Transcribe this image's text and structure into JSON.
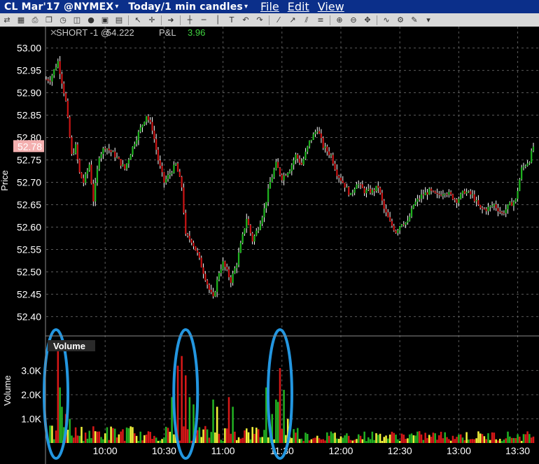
{
  "window": {
    "title": "CL Mar'17 @NYMEX",
    "title_arrow": "▾",
    "interval": "Today/1 min candles",
    "interval_arrow": "▾",
    "menu": [
      "File",
      "Edit",
      "View"
    ]
  },
  "toolbar": {
    "icons": [
      "arrow-icon",
      "grid-icon",
      "print-icon",
      "copy-icon",
      "clock-icon",
      "chart-icon",
      "circle-icon",
      "window-icon",
      "layout-icon",
      "sep",
      "cursor-icon",
      "crosshair-icon",
      "sep",
      "go-icon",
      "sep",
      "crosshair-line-icon",
      "hline-icon",
      "vline-icon",
      "text-icon",
      "undo-icon",
      "redo-icon",
      "sep",
      "trendline-icon",
      "ray-icon",
      "channel-icon",
      "fib-icon",
      "sep",
      "zoom-in-icon",
      "zoom-out-icon",
      "pan-icon",
      "sep",
      "indicator-icon",
      "settings-icon",
      "tools-icon",
      "chevron-down-icon"
    ]
  },
  "position": {
    "label": "SHORT -1 @",
    "price": "54.222",
    "pl_label": "P&L",
    "pl_value": "3.96",
    "close_glyph": "✕"
  },
  "colors": {
    "up": "#1fb31f",
    "down": "#c81414",
    "vol_up": "#22b022",
    "vol_down": "#d71818",
    "vol_flat": "#f2f23a",
    "annotation": "#2396e0",
    "last_price_bg": "#f4b0b0",
    "grid": "#5a5a5a"
  },
  "chart_data": [
    {
      "type": "candlestick",
      "title": "",
      "ylabel": "Price",
      "ylim": [
        52.36,
        53.04
      ],
      "y_ticks": [
        "53.00",
        "52.95",
        "52.90",
        "52.85",
        "52.80",
        "52.75",
        "52.70",
        "52.65",
        "52.60",
        "52.55",
        "52.50",
        "52.45",
        "52.40"
      ],
      "last_price": "52.78",
      "anchors": [
        [
          "09:32",
          52.93
        ],
        [
          "09:36",
          52.97
        ],
        [
          "09:40",
          52.88
        ],
        [
          "09:43",
          52.76
        ],
        [
          "09:45",
          52.78
        ],
        [
          "09:47",
          52.72
        ],
        [
          "09:49",
          52.7
        ],
        [
          "09:52",
          52.74
        ],
        [
          "09:54",
          52.66
        ],
        [
          "09:57",
          52.76
        ],
        [
          "10:00",
          52.78
        ],
        [
          "10:05",
          52.76
        ],
        [
          "10:10",
          52.73
        ],
        [
          "10:15",
          52.79
        ],
        [
          "10:18",
          52.82
        ],
        [
          "10:21",
          52.85
        ],
        [
          "10:24",
          52.82
        ],
        [
          "10:27",
          52.75
        ],
        [
          "10:30",
          52.7
        ],
        [
          "10:33",
          52.72
        ],
        [
          "10:36",
          52.74
        ],
        [
          "10:39",
          52.69
        ],
        [
          "10:41",
          52.58
        ],
        [
          "10:44",
          52.57
        ],
        [
          "10:47",
          52.54
        ],
        [
          "10:50",
          52.5
        ],
        [
          "10:53",
          52.46
        ],
        [
          "10:55",
          52.44
        ],
        [
          "10:58",
          52.5
        ],
        [
          "11:00",
          52.52
        ],
        [
          "11:04",
          52.48
        ],
        [
          "11:07",
          52.52
        ],
        [
          "11:10",
          52.58
        ],
        [
          "11:12",
          52.62
        ],
        [
          "11:15",
          52.57
        ],
        [
          "11:18",
          52.6
        ],
        [
          "11:21",
          52.64
        ],
        [
          "11:24",
          52.7
        ],
        [
          "11:27",
          52.74
        ],
        [
          "11:30",
          52.71
        ],
        [
          "11:34",
          52.73
        ],
        [
          "11:37",
          52.76
        ],
        [
          "11:40",
          52.74
        ],
        [
          "11:44",
          52.79
        ],
        [
          "11:48",
          52.82
        ],
        [
          "11:51",
          52.78
        ],
        [
          "11:55",
          52.76
        ],
        [
          "11:58",
          52.72
        ],
        [
          "12:01",
          52.7
        ],
        [
          "12:05",
          52.67
        ],
        [
          "12:08",
          52.7
        ],
        [
          "12:12",
          52.68
        ],
        [
          "12:16",
          52.68
        ],
        [
          "12:19",
          52.69
        ],
        [
          "12:22",
          52.64
        ],
        [
          "12:25",
          52.61
        ],
        [
          "12:28",
          52.59
        ],
        [
          "12:31",
          52.61
        ],
        [
          "12:34",
          52.61
        ],
        [
          "12:37",
          52.65
        ],
        [
          "12:41",
          52.67
        ],
        [
          "12:45",
          52.68
        ],
        [
          "12:49",
          52.67
        ],
        [
          "12:53",
          52.68
        ],
        [
          "12:56",
          52.67
        ],
        [
          "12:59",
          52.66
        ],
        [
          "13:03",
          52.68
        ],
        [
          "13:07",
          52.67
        ],
        [
          "13:11",
          52.64
        ],
        [
          "13:14",
          52.64
        ],
        [
          "13:18",
          52.65
        ],
        [
          "13:22",
          52.63
        ],
        [
          "13:26",
          52.65
        ],
        [
          "13:29",
          52.66
        ],
        [
          "13:32",
          52.73
        ],
        [
          "13:36",
          52.75
        ],
        [
          "13:38",
          52.78
        ]
      ]
    },
    {
      "type": "bar",
      "title": "Volume",
      "ylabel": "Volume",
      "ylim": [
        0,
        4200
      ],
      "y_ticks": [
        "3.0K",
        "2.0K",
        "1.0K"
      ],
      "x_ticks": [
        "10:00",
        "10:30",
        "11:00",
        "11:30",
        "12:00",
        "12:30",
        "13:00",
        "13:30"
      ],
      "spikes": [
        [
          "09:36",
          4100,
          "down"
        ],
        [
          "09:37",
          2300,
          "up"
        ],
        [
          "09:38",
          1500,
          "up"
        ],
        [
          "09:40",
          1200,
          "down"
        ],
        [
          "09:42",
          1000,
          "up"
        ],
        [
          "10:34",
          1900,
          "up"
        ],
        [
          "10:37",
          3200,
          "down"
        ],
        [
          "10:39",
          3600,
          "down"
        ],
        [
          "10:41",
          2800,
          "down"
        ],
        [
          "10:43",
          1900,
          "up"
        ],
        [
          "10:45",
          1600,
          "up"
        ],
        [
          "10:55",
          1800,
          "up"
        ],
        [
          "10:57",
          1500,
          "flat"
        ],
        [
          "11:03",
          1900,
          "down"
        ],
        [
          "11:05",
          1500,
          "up"
        ],
        [
          "11:22",
          2300,
          "up"
        ],
        [
          "11:25",
          1200,
          "up"
        ],
        [
          "11:27",
          1800,
          "up"
        ],
        [
          "11:28",
          1700,
          "up"
        ],
        [
          "11:29",
          3100,
          "down"
        ],
        [
          "11:31",
          2200,
          "up"
        ],
        [
          "11:33",
          1000,
          "flat"
        ]
      ]
    }
  ],
  "annotations": [
    {
      "shape": "ellipse",
      "x_time": "09:35"
    },
    {
      "shape": "ellipse",
      "x_time": "10:41"
    },
    {
      "shape": "ellipse",
      "x_time": "11:29"
    }
  ]
}
